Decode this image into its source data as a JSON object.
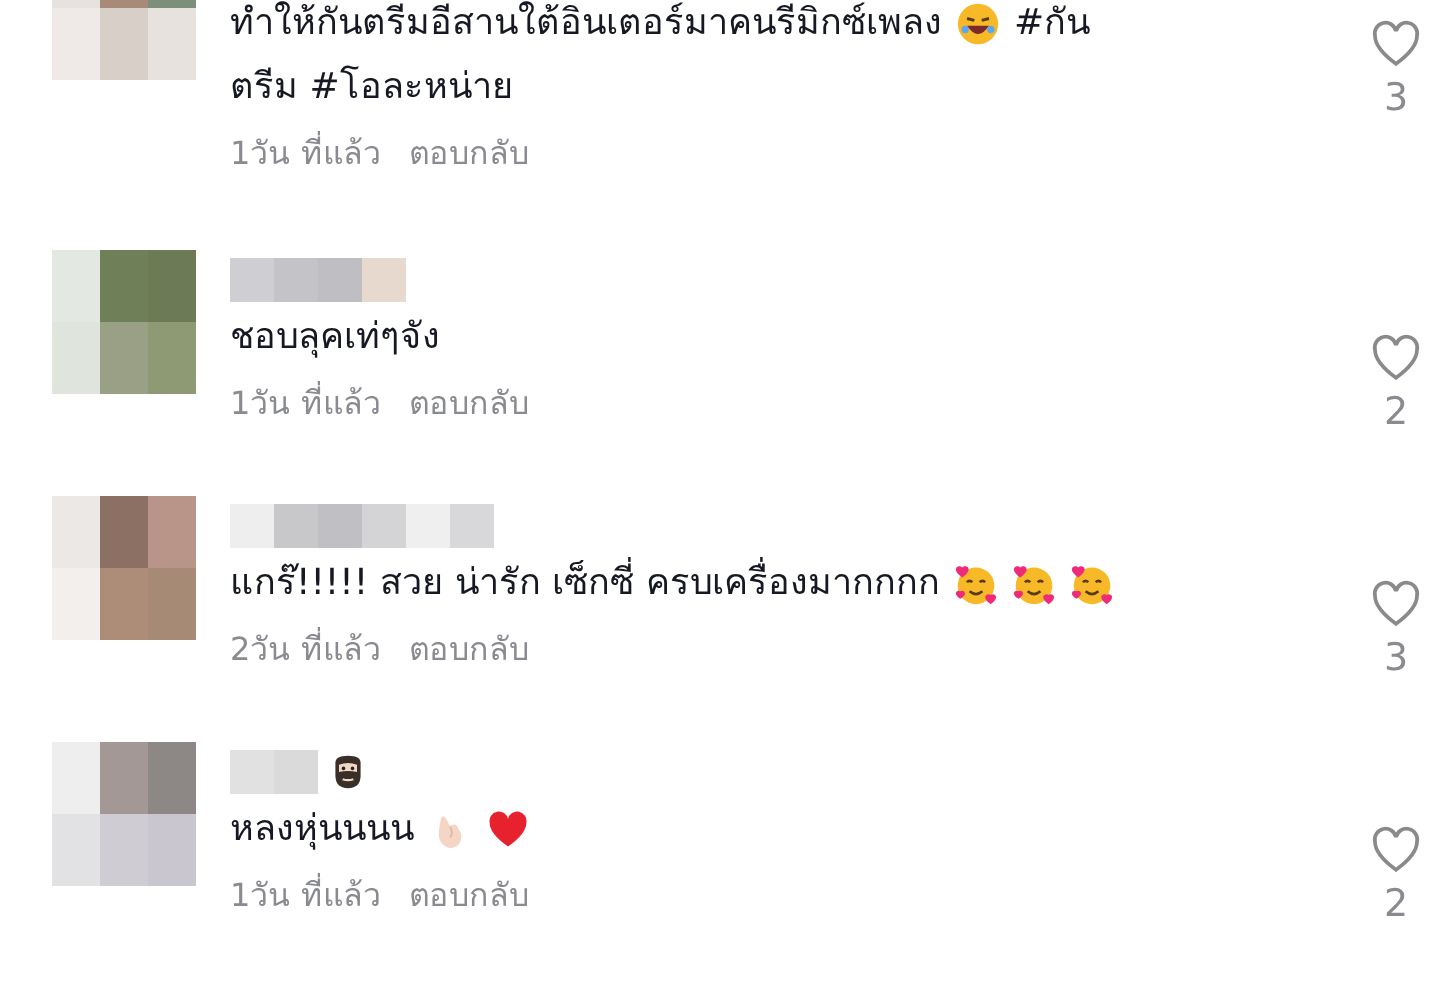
{
  "comments": [
    {
      "name_badge": false,
      "body": [
        {
          "kind": "text",
          "text": "ทำให้กันตรีมอีสานใต้อินเตอร์มาคนรีมิกซ์เพลง"
        },
        {
          "kind": "laughing"
        },
        {
          "kind": "text",
          "text": "#กัน"
        },
        {
          "kind": "text",
          "text": "ตรีม #โอละหน่าย"
        }
      ],
      "time": "1วัน ที่แล้ว",
      "reply": "ตอบกลับ",
      "likes": "3"
    },
    {
      "name_badge": false,
      "body": [
        {
          "kind": "text",
          "text": "ชอบลุคเท่ๆจัง"
        }
      ],
      "time": "1วัน ที่แล้ว",
      "reply": "ตอบกลับ",
      "likes": "2"
    },
    {
      "name_badge": false,
      "body": [
        {
          "kind": "text",
          "text": "แกร๊!!!!! สวย น่ารัก เซ็กซี่ ครบเครื่องมากกกก"
        },
        {
          "kind": "hearts"
        },
        {
          "kind": "hearts"
        },
        {
          "kind": "hearts"
        }
      ],
      "time": "2วัน ที่แล้ว",
      "reply": "ตอบกลับ",
      "likes": "3"
    },
    {
      "name_badge": true,
      "body": [
        {
          "kind": "text",
          "text": "หลงหุ่นนนน"
        },
        {
          "kind": "fingerheart"
        },
        {
          "kind": "redheart"
        }
      ],
      "time": "1วัน ที่แล้ว",
      "reply": "ตอบกลับ",
      "likes": "2"
    }
  ]
}
